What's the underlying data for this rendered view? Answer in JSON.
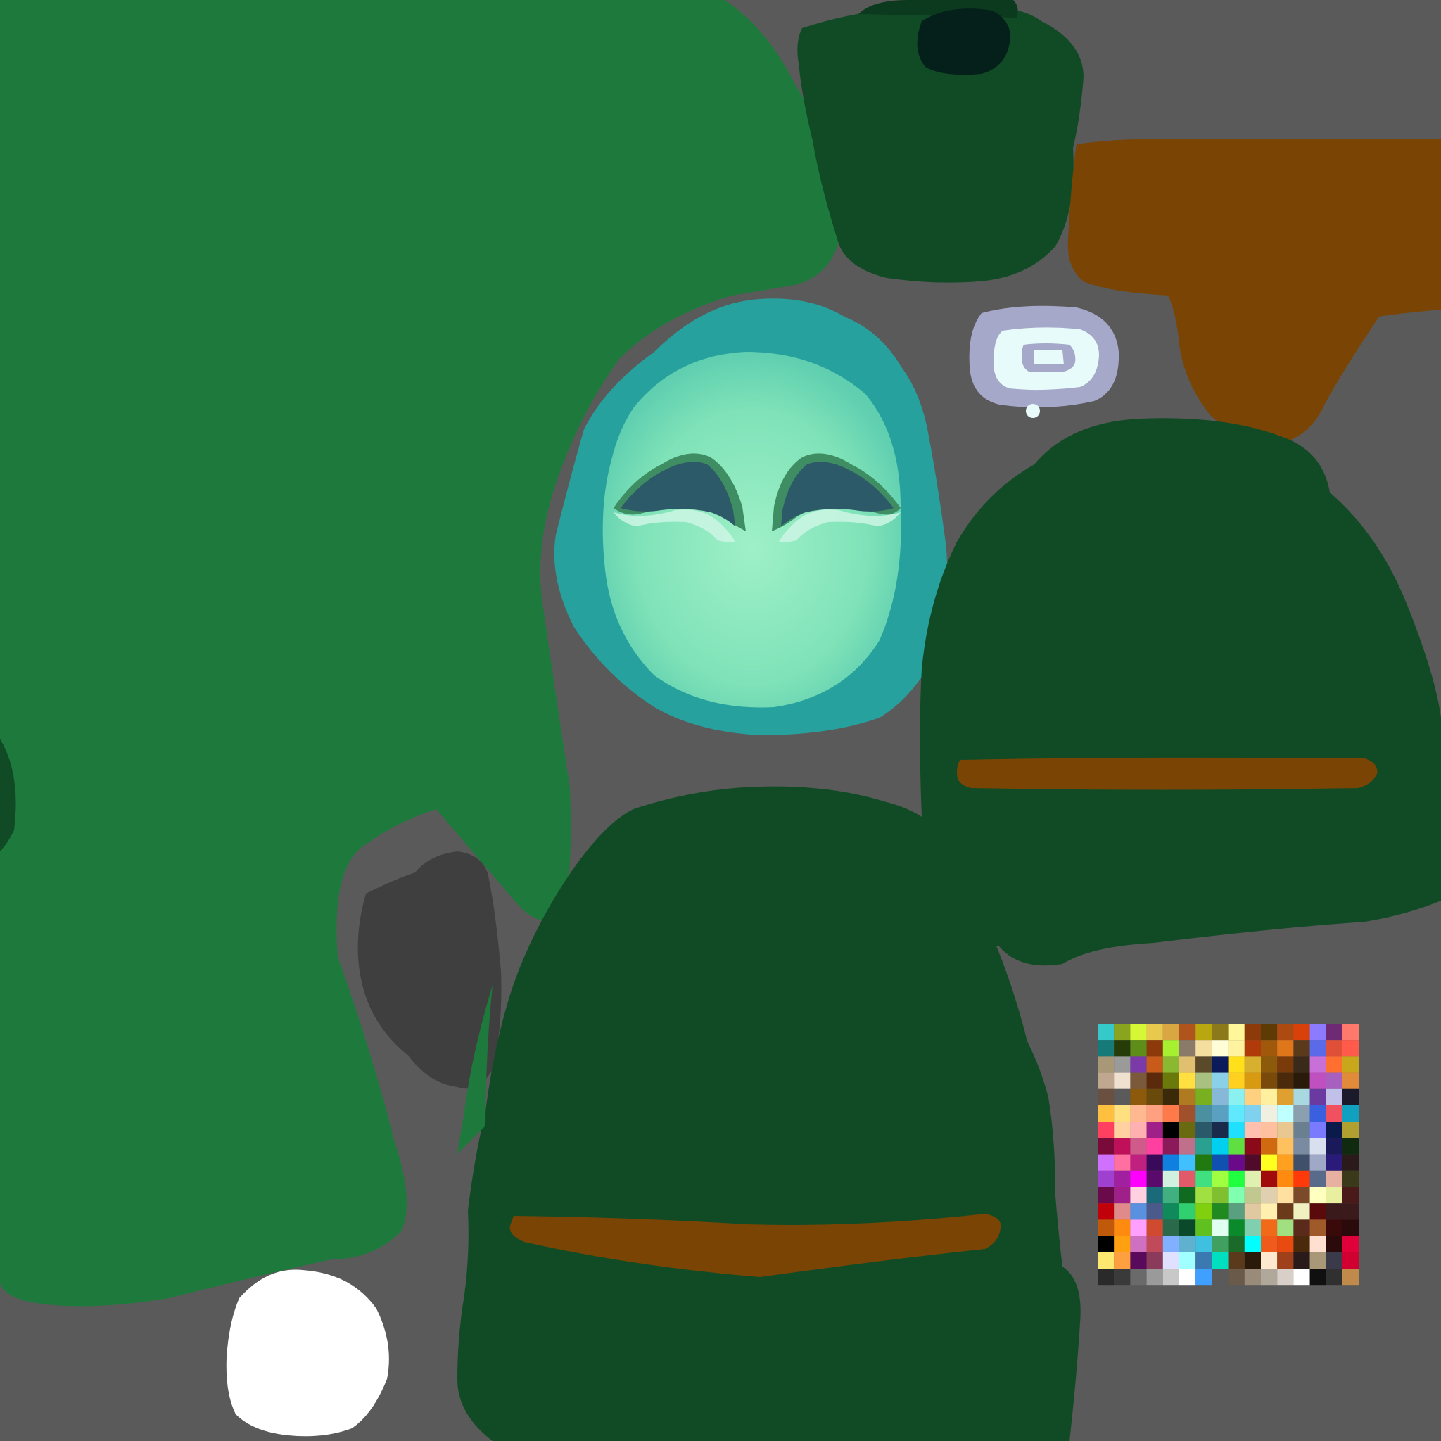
{
  "texture": {
    "background_color": "#5a5a5a",
    "colors": {
      "green_light": "#1e7a3c",
      "green_dark": "#114b26",
      "green_shadow": "#0b3a1e",
      "face_outer": "#27a19e",
      "face_inner": "#86e6b8",
      "face_glow": "#9ff0c8",
      "eye_dark": "#2c5a68",
      "eye_outline": "#3f8d62",
      "eye_highlight": "#cdf6e4",
      "brown": "#7a4504",
      "gray_dark": "#3f3f3f",
      "white": "#ffffff",
      "ring_outer": "#a5a8c8",
      "ring_inner": "#e8fbfb"
    },
    "palette": {
      "columns": 16,
      "rows": 16,
      "colors": [
        "#36c9c9",
        "#8aa51d",
        "#d6f735",
        "#e8c94d",
        "#d9a642",
        "#b0541e",
        "#b8a70f",
        "#8c7a1a",
        "#fff79a",
        "#8c3a0a",
        "#5e3a05",
        "#ad4a12",
        "#d8420a",
        "#8c7aff",
        "#6e2a73",
        "#ff7a6a",
        "#157a78",
        "#253b08",
        "#5e8d1a",
        "#8c3a0a",
        "#a7f030",
        "#8a7a6a",
        "#f5dfa0",
        "#fffdd8",
        "#fff3a0",
        "#b03a0a",
        "#a0580a",
        "#e0761a",
        "#5a3a1a",
        "#5a6ae8",
        "#e05038",
        "#ff5a4a",
        "#a89878",
        "#9a9a98",
        "#7a3aa8",
        "#c85a1a",
        "#8ab830",
        "#e0c070",
        "#5a4a2a",
        "#0a1a5a",
        "#ffe01a",
        "#d8b030",
        "#8c5a0a",
        "#7a3a0a",
        "#3a2a1a",
        "#c870d8",
        "#ff7030",
        "#c8a81a",
        "#c0a890",
        "#f0e0d0",
        "#7a5a3a",
        "#5a2a0a",
        "#6a7a0a",
        "#ffe040",
        "#a8c080",
        "#8ad0e8",
        "#ffd020",
        "#d89a10",
        "#7a4a0a",
        "#4a2a0a",
        "#2a1a0a",
        "#c050c0",
        "#a860c0",
        "#e08a3a",
        "#6a5040",
        "#5a5a5a",
        "#8c5a0a",
        "#6a4a0a",
        "#3a2a0a",
        "#b07a20",
        "#78b020",
        "#88b8d8",
        "#8af0f0",
        "#ffd080",
        "#fff0a0",
        "#e0a030",
        "#a8d8e0",
        "#6a3aa0",
        "#c0c0e8",
        "#1a1a2a",
        "#ffc040",
        "#ffe080",
        "#ffb890",
        "#ffa080",
        "#ff7a4a",
        "#a0502a",
        "#4a90a0",
        "#5aa0c0",
        "#60e8ff",
        "#80d0f0",
        "#f0f0e0",
        "#c0ffff",
        "#8aa0b0",
        "#3a60e0",
        "#f05060",
        "#10a0c0",
        "#ff4060",
        "#ffd0a0",
        "#ffb0b0",
        "#a0208a",
        "#000000",
        "#6a6a10",
        "#2a5a6a",
        "#1a2a4a",
        "#20e0ff",
        "#ffc0b0",
        "#ffc0a0",
        "#e8c890",
        "#6a8090",
        "#7a7aff",
        "#0a1a4a",
        "#b0a030",
        "#7a0a3a",
        "#c0105a",
        "#d05a8a",
        "#ff40a0",
        "#8a1a5a",
        "#c0708a",
        "#2aa090",
        "#00d0f0",
        "#60e040",
        "#8a0a1a",
        "#d06a10",
        "#ffc060",
        "#7a8aa0",
        "#d8e0f0",
        "#1a1a5a",
        "#102a10",
        "#d070ff",
        "#ff70a0",
        "#c02080",
        "#3a0a5a",
        "#1080e0",
        "#40c0ff",
        "#207a10",
        "#1050b0",
        "#6a0a8a",
        "#500a2a",
        "#ffff20",
        "#ffa020",
        "#40506a",
        "#a0a8c8",
        "#2a1a7a",
        "#2a1a1a",
        "#a040d0",
        "#a020a0",
        "#ff00ff",
        "#5a0a6a",
        "#d0f0e0",
        "#e05a6a",
        "#40e080",
        "#a0ff40",
        "#20ff40",
        "#e0f0b0",
        "#a00a0a",
        "#ff8a10",
        "#ff3a0a",
        "#5a6a8a",
        "#e8b0a0",
        "#3a3a1a",
        "#6a0a4a",
        "#a0208a",
        "#ffd0e0",
        "#1a6a7a",
        "#40b080",
        "#106a20",
        "#a0e040",
        "#80c030",
        "#80ffb0",
        "#c0c890",
        "#e0d0b0",
        "#ffe0a0",
        "#7a4a2a",
        "#ffffc0",
        "#e8f0a0",
        "#4a1a1a",
        "#c0000a",
        "#e08a8a",
        "#5a90e0",
        "#4a5a8a",
        "#108a5a",
        "#30d070",
        "#80d010",
        "#208a20",
        "#5aa080",
        "#e0c8a0",
        "#fff0b0",
        "#6a3a1a",
        "#f0f0c0",
        "#5a0a0a",
        "#3a1a1a",
        "#3a1a1a",
        "#c05a0a",
        "#ff8a10",
        "#ffa0ff",
        "#d04a30",
        "#2a6a4a",
        "#0a4a2a",
        "#60c020",
        "#e0fff0",
        "#0a8a2a",
        "#80d0b0",
        "#f06a1a",
        "#a0e080",
        "#5a2a1a",
        "#a05a2a",
        "#3a0a0a",
        "#2a0a0a",
        "#000000",
        "#ffa010",
        "#d070c0",
        "#c04a5a",
        "#80b0ff",
        "#60b0d0",
        "#40c0e0",
        "#40a060",
        "#1a6a2a",
        "#00ffff",
        "#f05a1a",
        "#e84a10",
        "#4a2a0a",
        "#ffe0d0",
        "#2a0a0a",
        "#e0003a",
        "#ffe870",
        "#ffa040",
        "#5a0a5a",
        "#8a3a5a",
        "#e0e0ff",
        "#a0ffff",
        "#3a7ab0",
        "#00e0c0",
        "#5a3a1a",
        "#2a1a0a",
        "#ffe8d0",
        "#a0401a",
        "#2a1a1a",
        "#a89878",
        "#3a3a4a",
        "#d00030",
        "#2a2a2a",
        "#3a3a3a",
        "#6a6a6a",
        "#9a9a9a",
        "#c8c8c8",
        "#ffffff",
        "#40a0ff",
        "#5a5a5a",
        "#6a5a4a",
        "#9a8a7a",
        "#b0a89a",
        "#d8d0c8",
        "#ffffff",
        "#101010",
        "#303030",
        "#c08a4a"
      ]
    }
  }
}
